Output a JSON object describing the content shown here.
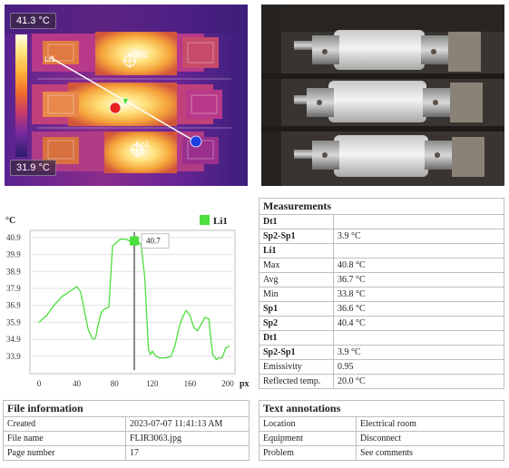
{
  "thermal_image": {
    "max_temp": "41.3 °C",
    "min_temp": "31.9 °C",
    "line_label": "Li1",
    "spot1_label": "Sp1",
    "spot2_label": "Sp2",
    "colors": {
      "hot": "#fffde8",
      "warm": "#ffb53a",
      "mid": "#e05a3a",
      "cool": "#7a2aa0",
      "cold": "#2a1c6e"
    }
  },
  "chart_data": {
    "type": "line",
    "ylabel": "°C",
    "xlabel": "px",
    "xlim": [
      0,
      200
    ],
    "ylim": [
      33.3,
      41.0
    ],
    "xticks": [
      0,
      40,
      80,
      120,
      160,
      200
    ],
    "yticks": [
      33.9,
      34.9,
      35.9,
      36.9,
      37.9,
      38.9,
      39.9,
      40.9
    ],
    "ytick_labels": [
      "33.9",
      "34.9",
      "35.9",
      "36.9",
      "37.9",
      "38.9",
      "39.9",
      "40.9"
    ],
    "xtick_labels": [
      "0",
      "40",
      "80",
      "120",
      "160",
      "200"
    ],
    "cursor": {
      "x": 101,
      "label": "40.7"
    },
    "legend": "Li1",
    "series": [
      {
        "name": "Li1",
        "color": "#4ddf3c",
        "x": [
          0,
          8,
          16,
          24,
          32,
          40,
          44,
          48,
          52,
          56,
          58,
          60,
          62,
          66,
          70,
          74,
          76,
          78,
          80,
          82,
          84,
          86,
          88,
          92,
          96,
          100,
          104,
          108,
          112,
          114,
          116,
          118,
          120,
          124,
          128,
          134,
          140,
          144,
          148,
          152,
          156,
          160,
          164,
          168,
          172,
          176,
          180,
          182,
          184,
          188,
          190,
          194,
          198,
          202
        ],
        "y": [
          35.9,
          36.3,
          36.9,
          37.4,
          37.7,
          38.0,
          37.7,
          36.6,
          35.5,
          35.0,
          34.9,
          35.0,
          35.6,
          36.5,
          36.7,
          36.8,
          38.6,
          40.4,
          40.5,
          40.6,
          40.7,
          40.8,
          40.8,
          40.8,
          40.7,
          40.8,
          40.7,
          40.5,
          38.6,
          36.4,
          34.3,
          34.0,
          34.2,
          33.9,
          33.8,
          33.8,
          33.9,
          34.5,
          35.5,
          36.2,
          36.6,
          36.3,
          35.6,
          35.4,
          35.8,
          36.2,
          36.1,
          35.0,
          34.0,
          33.7,
          33.8,
          33.8,
          34.4,
          34.5
        ]
      }
    ]
  },
  "measurements": {
    "title": "Measurements",
    "rows": [
      {
        "label": "Dt1",
        "value": "",
        "bold": true
      },
      {
        "label": "Sp2-Sp1",
        "value": "3.9 °C",
        "bold": true
      },
      {
        "label": "Li1",
        "value": "",
        "bold": true
      },
      {
        "label": "Max",
        "value": "40.8 °C",
        "bold": false
      },
      {
        "label": "Avg",
        "value": "36.7 °C",
        "bold": false
      },
      {
        "label": "Min",
        "value": "33.8 °C",
        "bold": false
      },
      {
        "label": "Sp1",
        "value": "36.6 °C",
        "bold": true
      },
      {
        "label": "Sp2",
        "value": "40.4 °C",
        "bold": true
      },
      {
        "label": "Dt1",
        "value": "",
        "bold": true
      },
      {
        "label": "Sp2-Sp1",
        "value": "3.9 °C",
        "bold": true
      },
      {
        "label": "Emissivity",
        "value": "0.95",
        "bold": false
      },
      {
        "label": "Reflected temp.",
        "value": "20.0 °C",
        "bold": false
      }
    ]
  },
  "file_information": {
    "title": "File information",
    "rows": [
      {
        "label": "Created",
        "value": "2023-07-07 11:41:13 AM"
      },
      {
        "label": "File name",
        "value": "FLIR3063.jpg"
      },
      {
        "label": "Page number",
        "value": "17"
      }
    ]
  },
  "text_annotations": {
    "title": "Text annotations",
    "rows": [
      {
        "label": "Location",
        "value": "Electrical room"
      },
      {
        "label": "Equipment",
        "value": "Disconnect"
      },
      {
        "label": "Problem",
        "value": "See comments"
      }
    ]
  }
}
